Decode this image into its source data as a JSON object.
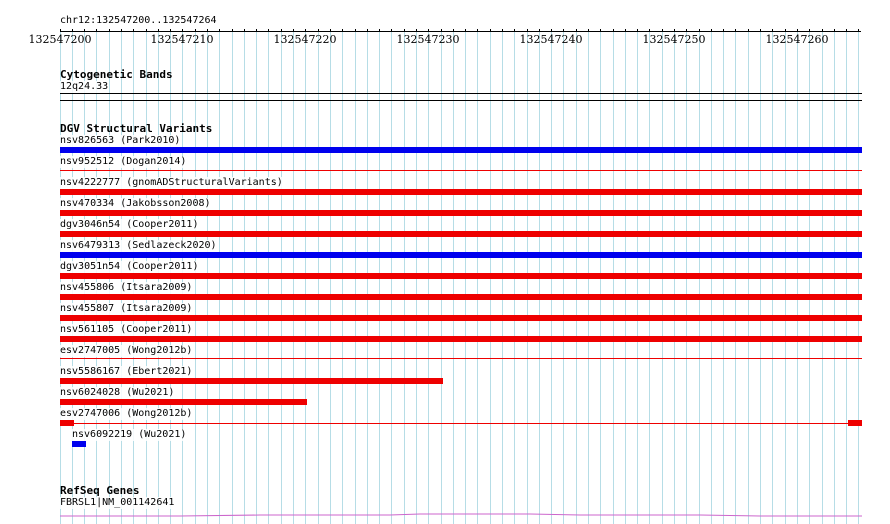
{
  "ruler": {
    "region": "chr12:132547200..132547264",
    "ticks": [
      "132547200",
      "132547210",
      "132547220",
      "132547230",
      "132547240",
      "132547250",
      "132547260"
    ]
  },
  "cytoband": {
    "title": "Cytogenetic Bands",
    "band": "12q24.33"
  },
  "dgv": {
    "title": "DGV Structural Variants",
    "colors": {
      "gain": "#0000ee",
      "loss": "#ee0000"
    },
    "features": [
      {
        "label": "nsv826563 (Park2010)",
        "type": "gain"
      },
      {
        "label": "nsv952512 (Dogan2014)",
        "type": "loss"
      },
      {
        "label": "nsv4222777 (gnomADStructuralVariants)",
        "type": "loss"
      },
      {
        "label": "nsv470334 (Jakobsson2008)",
        "type": "loss"
      },
      {
        "label": "dgv3046n54 (Cooper2011)",
        "type": "loss"
      },
      {
        "label": "nsv6479313 (Sedlazeck2020)",
        "type": "gain"
      },
      {
        "label": "dgv3051n54 (Cooper2011)",
        "type": "loss"
      },
      {
        "label": "nsv455806 (Itsara2009)",
        "type": "loss"
      },
      {
        "label": "nsv455807 (Itsara2009)",
        "type": "loss"
      },
      {
        "label": "nsv561105 (Cooper2011)",
        "type": "loss"
      },
      {
        "label": "esv2747005 (Wong2012b)",
        "type": "loss"
      },
      {
        "label": "nsv5586167 (Ebert2021)",
        "type": "loss"
      },
      {
        "label": "nsv6024028 (Wu2021)",
        "type": "loss"
      },
      {
        "label": "esv2747006 (Wong2012b)",
        "type": "loss"
      },
      {
        "label": "nsv6092219 (Wu2021)",
        "type": "gain"
      }
    ]
  },
  "refseq": {
    "title": "RefSeq Genes",
    "gene": "FBRSL1|NM_001142641",
    "color": "#cc66cc"
  }
}
